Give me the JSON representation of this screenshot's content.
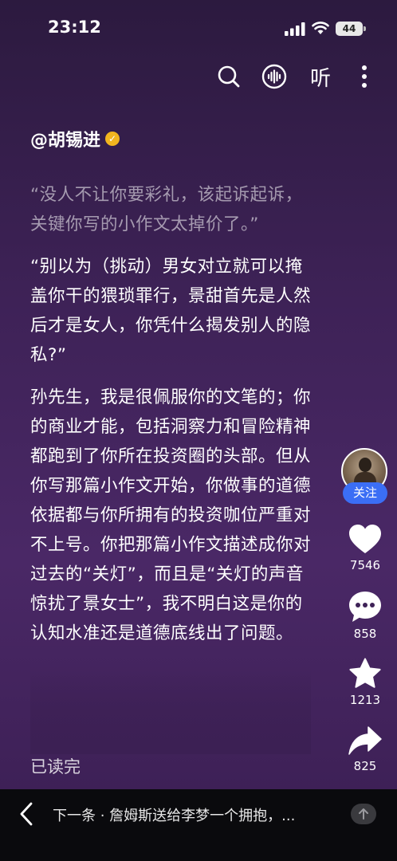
{
  "status_bar": {
    "time": "23:12",
    "battery": "44"
  },
  "toolbar": {
    "listen_label": "听"
  },
  "author": {
    "name": "@胡锡进"
  },
  "article": {
    "paragraphs": [
      "“没人不让你要彩礼，该起诉起诉，关键你写的小作文太掉价了。”",
      "“别以为（挑动）男女对立就可以掩盖你干的猥琐罪行，景甜首先是人然后才是女人，你凭什么揭发别人的隐私?”",
      "孙先生，我是很佩服你的文笔的；你的商业才能，包括洞察力和冒险精神都跑到了你所在投资圈的头部。但从你写那篇小作文开始，你做事的道德依据都与你所拥有的投资咖位严重对不上号。你把那篇小作文描述成你对过去的“关灯”，而且是“关灯的声音惊扰了景女士”，我不明白这是你的认知水准还是道德底线出了问题。"
    ],
    "read_done": "已读完"
  },
  "actions": {
    "follow_label": "关注",
    "like_count": "7546",
    "comment_count": "858",
    "favorite_count": "1213",
    "share_count": "825"
  },
  "bottom_bar": {
    "next_text": "下一条 · 詹姆斯送给李梦一个拥抱，..."
  },
  "colors": {
    "follow_blue": "#3b6ef5",
    "verified_gold": "#f2b51f",
    "bg_purple": "#3e2257"
  }
}
